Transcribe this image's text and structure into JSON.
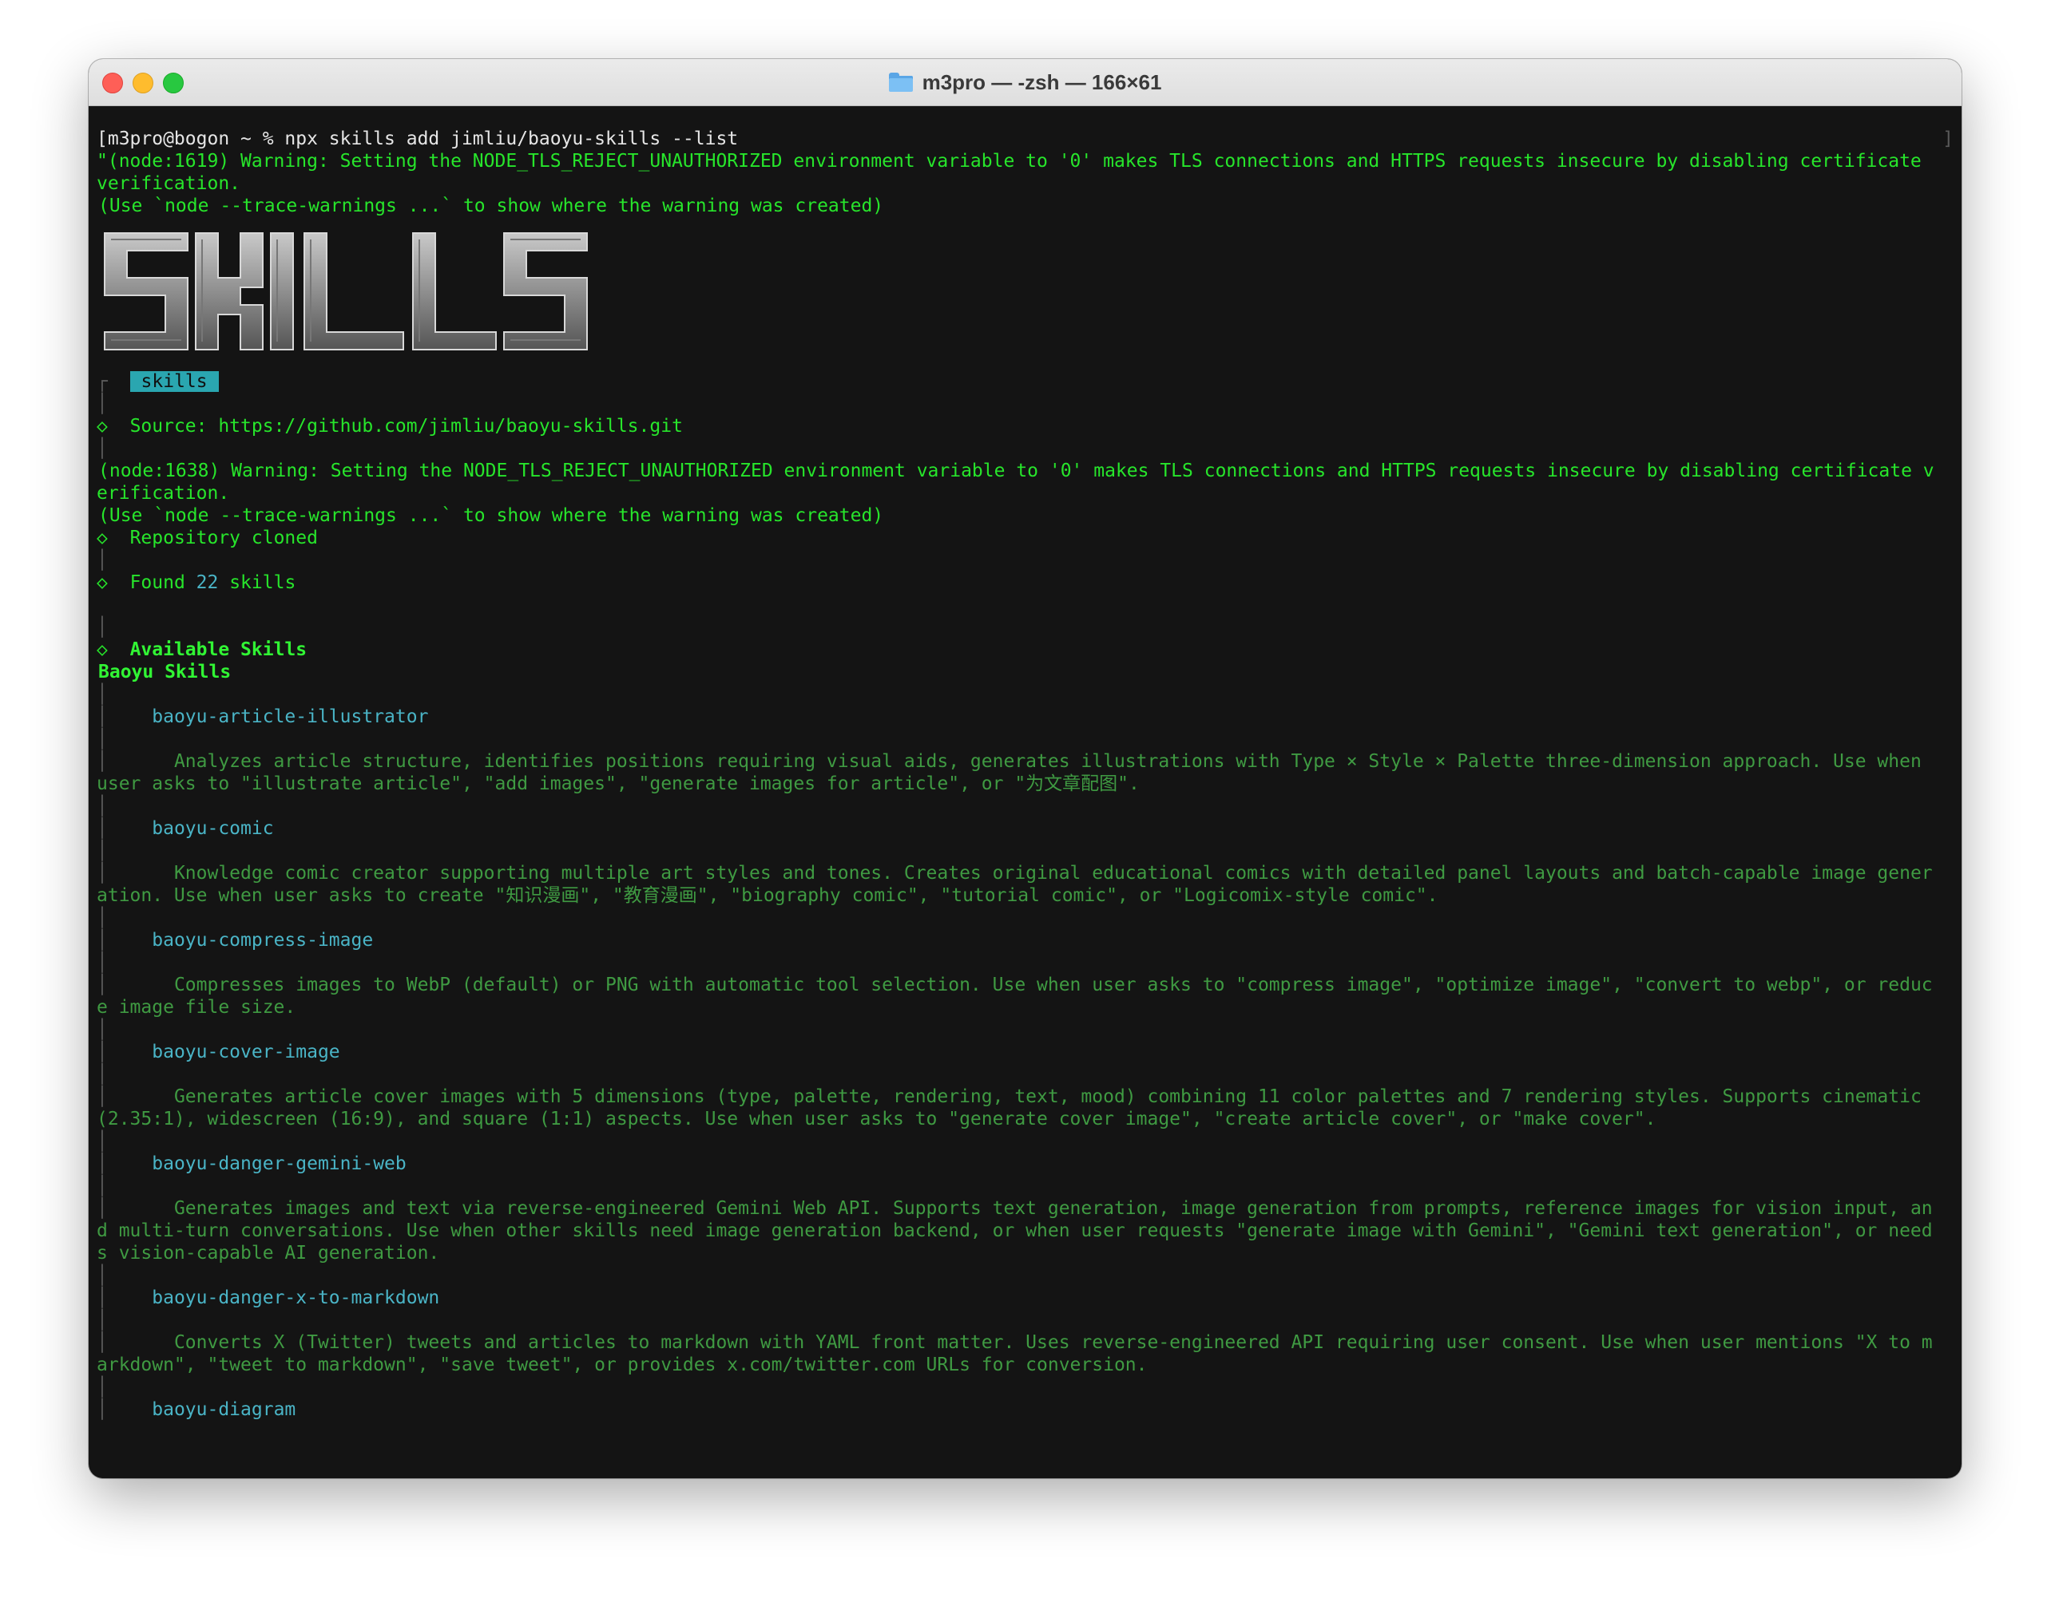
{
  "window": {
    "title": "m3pro — -zsh — 166×61"
  },
  "terminal": {
    "prompt": "[m3pro@bogon ~ % npx skills add jimliu/baoyu-skills --list",
    "warn1_a": "\"(node:1619) Warning: Setting the NODE_TLS_REJECT_UNAUTHORIZED environment variable to '0' makes TLS connections and HTTPS requests insecure by disabling certificate",
    "warn1_b": "verification.",
    "warn1_c": "(Use `node --trace-warnings ...` to show where the warning was created)",
    "logo_text": "SKILLS",
    "badge": "skills",
    "source": "Source: https://github.com/jimliu/baoyu-skills.git",
    "warn2_a": "(node:1638) Warning: Setting the NODE_TLS_REJECT_UNAUTHORIZED environment variable to '0' makes TLS connections and HTTPS requests insecure by disabling certificate v",
    "warn2_b": "erification.",
    "warn2_c": "(Use `node --trace-warnings ...` to show where the warning was created)",
    "cloned": "Repository cloned",
    "found_prefix": "Found ",
    "found_count": "22",
    "found_suffix": " skills",
    "available": "Available Skills",
    "group": "Baoyu Skills"
  },
  "skills": [
    {
      "name": "baoyu-article-illustrator",
      "desc": [
        "Analyzes article structure, identifies positions requiring visual aids, generates illustrations with Type × Style × Palette three-dimension approach. Use when",
        "user asks to \"illustrate article\", \"add images\", \"generate images for article\", or \"为文章配图\"."
      ]
    },
    {
      "name": "baoyu-comic",
      "desc": [
        "Knowledge comic creator supporting multiple art styles and tones. Creates original educational comics with detailed panel layouts and batch-capable image gener",
        "ation. Use when user asks to create \"知识漫画\", \"教育漫画\", \"biography comic\", \"tutorial comic\", or \"Logicomix-style comic\"."
      ]
    },
    {
      "name": "baoyu-compress-image",
      "desc": [
        "Compresses images to WebP (default) or PNG with automatic tool selection. Use when user asks to \"compress image\", \"optimize image\", \"convert to webp\", or reduc",
        "e image file size."
      ]
    },
    {
      "name": "baoyu-cover-image",
      "desc": [
        "Generates article cover images with 5 dimensions (type, palette, rendering, text, mood) combining 11 color palettes and 7 rendering styles. Supports cinematic",
        "(2.35:1), widescreen (16:9), and square (1:1) aspects. Use when user asks to \"generate cover image\", \"create article cover\", or \"make cover\"."
      ]
    },
    {
      "name": "baoyu-danger-gemini-web",
      "desc": [
        "Generates images and text via reverse-engineered Gemini Web API. Supports text generation, image generation from prompts, reference images for vision input, an",
        "d multi-turn conversations. Use when other skills need image generation backend, or when user requests \"generate image with Gemini\", \"Gemini text generation\", or need",
        "s vision-capable AI generation."
      ]
    },
    {
      "name": "baoyu-danger-x-to-markdown",
      "desc": [
        "Converts X (Twitter) tweets and articles to markdown with YAML front matter. Uses reverse-engineered API requiring user consent. Use when user mentions \"X to m",
        "arkdown\", \"tweet to markdown\", \"save tweet\", or provides x.com/twitter.com URLs for conversion."
      ]
    },
    {
      "name": "baoyu-diagram",
      "desc": []
    }
  ]
}
